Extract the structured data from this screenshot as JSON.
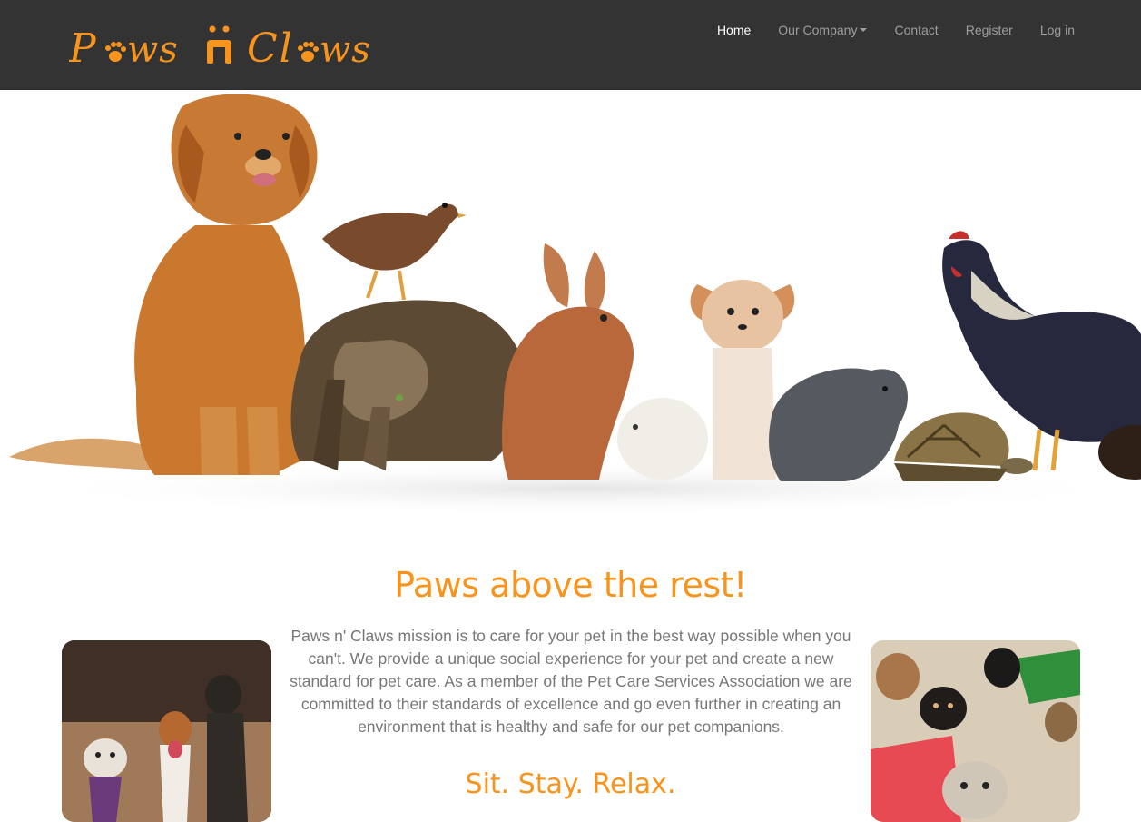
{
  "brand": {
    "logo_text_1": "Paws",
    "logo_text_2": "Claws",
    "logo_icon": "paw-print-icon",
    "accent_color": "#f7941d"
  },
  "nav": {
    "items": [
      {
        "label": "Home",
        "active": true
      },
      {
        "label": "Our Company",
        "dropdown": true
      },
      {
        "label": "Contact"
      },
      {
        "label": "Register"
      },
      {
        "label": "Log in"
      }
    ]
  },
  "hero": {
    "image": "group-of-pets-banner"
  },
  "main": {
    "headline": "Paws above the rest!",
    "mission": "Paws n' Claws mission is to care for your pet in the best way possible when you can't. We provide a unique social experience for your pet and create a new standard for pet care. As a member of the Pet Care Services Association we are committed to their standards of excellence and go even further in creating an environment that is healthy and safe for our pet companions.",
    "subheadline": "Sit. Stay. Relax.",
    "left_photo": "dogs-running-photo",
    "right_photo": "dogs-group-photo"
  }
}
